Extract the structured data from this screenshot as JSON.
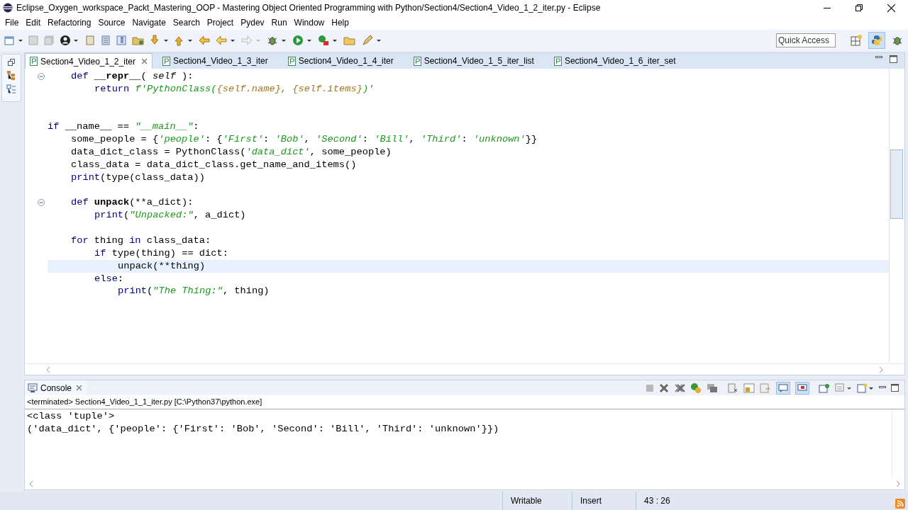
{
  "window": {
    "title": "Eclipse_Oxygen_workspace_Packt_Mastering_OOP - Mastering Object Oriented Programming with Python/Section4/Section4_Video_1_2_iter.py - Eclipse"
  },
  "menu": [
    "File",
    "Edit",
    "Refactoring",
    "Source",
    "Navigate",
    "Search",
    "Project",
    "Pydev",
    "Run",
    "Window",
    "Help"
  ],
  "quick_access": {
    "placeholder": "Quick Access"
  },
  "editor_tabs": [
    {
      "label": "Section4_Video_1_2_iter",
      "selected": true
    },
    {
      "label": "Section4_Video_1_3_iter",
      "selected": false
    },
    {
      "label": "Section4_Video_1_4_iter",
      "selected": false
    },
    {
      "label": "Section4_Video_1_5_iter_list",
      "selected": false
    },
    {
      "label": "Section4_Video_1_6_iter_set",
      "selected": false
    }
  ],
  "code_lines": [
    {
      "kind": "body",
      "children": [
        {
          "kind": "code",
          "foldable": true,
          "current": false,
          "tokens": [
            {
              "text": "def",
              "kind": "keyword"
            },
            {
              "text": " __repr__",
              "kind": "name"
            },
            {
              "text": "( ",
              "kind": "plain"
            },
            {
              "text": "self",
              "kind": "param"
            },
            {
              "text": " ):",
              "kind": "plain"
            }
          ],
          "children": [
            {
              "kind": "code",
              "foldable": false,
              "current": false,
              "tokens": [
                {
                  "text": "return",
                  "kind": "keyword"
                },
                {
                  "text": " f'PythonClass(",
                  "kind": "string"
                },
                {
                  "text": "{self.name}",
                  "kind": "interpolation"
                },
                {
                  "text": ", ",
                  "kind": "string"
                },
                {
                  "text": "{self.items}",
                  "kind": "interpolation"
                },
                {
                  "text": ")'",
                  "kind": "string"
                }
              ]
            }
          ]
        }
      ]
    },
    {
      "kind": "blank",
      "foldable": false,
      "current": false
    },
    {
      "kind": "blank",
      "foldable": false,
      "current": false
    },
    {
      "kind": "code",
      "foldable": false,
      "current": false,
      "tokens": [
        {
          "text": "if",
          "kind": "keyword"
        },
        {
          "text": " __name__ == ",
          "kind": "plain"
        },
        {
          "text": "\"__main__\"",
          "kind": "string"
        },
        {
          "text": ":",
          "kind": "plain"
        }
      ],
      "children": [
        {
          "kind": "code",
          "foldable": false,
          "current": false,
          "tokens": [
            {
              "text": "some_people = {",
              "kind": "plain"
            },
            {
              "text": "'people'",
              "kind": "string"
            },
            {
              "text": ": {",
              "kind": "plain"
            },
            {
              "text": "'First'",
              "kind": "string"
            },
            {
              "text": ": ",
              "kind": "plain"
            },
            {
              "text": "'Bob'",
              "kind": "string"
            },
            {
              "text": ", ",
              "kind": "plain"
            },
            {
              "text": "'Second'",
              "kind": "string"
            },
            {
              "text": ": ",
              "kind": "plain"
            },
            {
              "text": "'Bill'",
              "kind": "string"
            },
            {
              "text": ", ",
              "kind": "plain"
            },
            {
              "text": "'Third'",
              "kind": "string"
            },
            {
              "text": ": ",
              "kind": "plain"
            },
            {
              "text": "'unknown'",
              "kind": "string"
            },
            {
              "text": "}}",
              "kind": "plain"
            }
          ]
        },
        {
          "kind": "code",
          "foldable": false,
          "current": false,
          "tokens": [
            {
              "text": "data_dict_class = PythonClass(",
              "kind": "plain"
            },
            {
              "text": "'data_dict'",
              "kind": "string"
            },
            {
              "text": ", some_people)",
              "kind": "plain"
            }
          ]
        },
        {
          "kind": "code",
          "foldable": false,
          "current": false,
          "tokens": [
            {
              "text": "class_data = data_dict_class.get_name_and_items()",
              "kind": "plain"
            }
          ]
        },
        {
          "kind": "code",
          "foldable": false,
          "current": false,
          "tokens": [
            {
              "text": "print",
              "kind": "keyword"
            },
            {
              "text": "(type(class_data))",
              "kind": "plain"
            }
          ]
        },
        {
          "kind": "blank",
          "foldable": false,
          "current": false
        },
        {
          "kind": "code",
          "foldable": true,
          "current": false,
          "tokens": [
            {
              "text": "def",
              "kind": "keyword"
            },
            {
              "text": " unpack",
              "kind": "name"
            },
            {
              "text": "(**a_dict):",
              "kind": "plain"
            }
          ],
          "children": [
            {
              "kind": "code",
              "foldable": false,
              "current": false,
              "tokens": [
                {
                  "text": "print",
                  "kind": "keyword"
                },
                {
                  "text": "(",
                  "kind": "plain"
                },
                {
                  "text": "\"Unpacked:\"",
                  "kind": "string"
                },
                {
                  "text": ", a_dict)",
                  "kind": "plain"
                }
              ]
            }
          ]
        },
        {
          "kind": "blank",
          "foldable": false,
          "current": false
        },
        {
          "kind": "code",
          "foldable": false,
          "current": false,
          "tokens": [
            {
              "text": "for",
              "kind": "keyword"
            },
            {
              "text": " thing ",
              "kind": "plain"
            },
            {
              "text": "in",
              "kind": "keyword"
            },
            {
              "text": " class_data:",
              "kind": "plain"
            }
          ],
          "children": [
            {
              "kind": "code",
              "foldable": false,
              "current": false,
              "tokens": [
                {
                  "text": "if",
                  "kind": "keyword"
                },
                {
                  "text": " type(thing) == dict:",
                  "kind": "plain"
                }
              ],
              "children": [
                {
                  "kind": "code",
                  "foldable": false,
                  "current": true,
                  "tokens": [
                    {
                      "text": "unpack(**thing)",
                      "kind": "plain"
                    }
                  ]
                }
              ]
            },
            {
              "kind": "code",
              "foldable": false,
              "current": false,
              "tokens": [
                {
                  "text": "else",
                  "kind": "keyword"
                },
                {
                  "text": ":",
                  "kind": "plain"
                }
              ],
              "children": [
                {
                  "kind": "code",
                  "foldable": false,
                  "current": false,
                  "tokens": [
                    {
                      "text": "print",
                      "kind": "keyword"
                    },
                    {
                      "text": "(",
                      "kind": "plain"
                    },
                    {
                      "text": "\"The Thing:\"",
                      "kind": "string"
                    },
                    {
                      "text": ", thing)",
                      "kind": "plain"
                    }
                  ]
                }
              ]
            }
          ]
        }
      ]
    }
  ],
  "console": {
    "tab": "Console",
    "status": "<terminated> Section4_Video_1_1_iter.py [C:\\Python37\\python.exe]",
    "output": [
      "<class 'tuple'>",
      "('data_dict', {'people': {'First': 'Bob', 'Second': 'Bill', 'Third': 'unknown'}})"
    ]
  },
  "status_bar": [
    "Writable",
    "Insert",
    "43 : 26"
  ]
}
